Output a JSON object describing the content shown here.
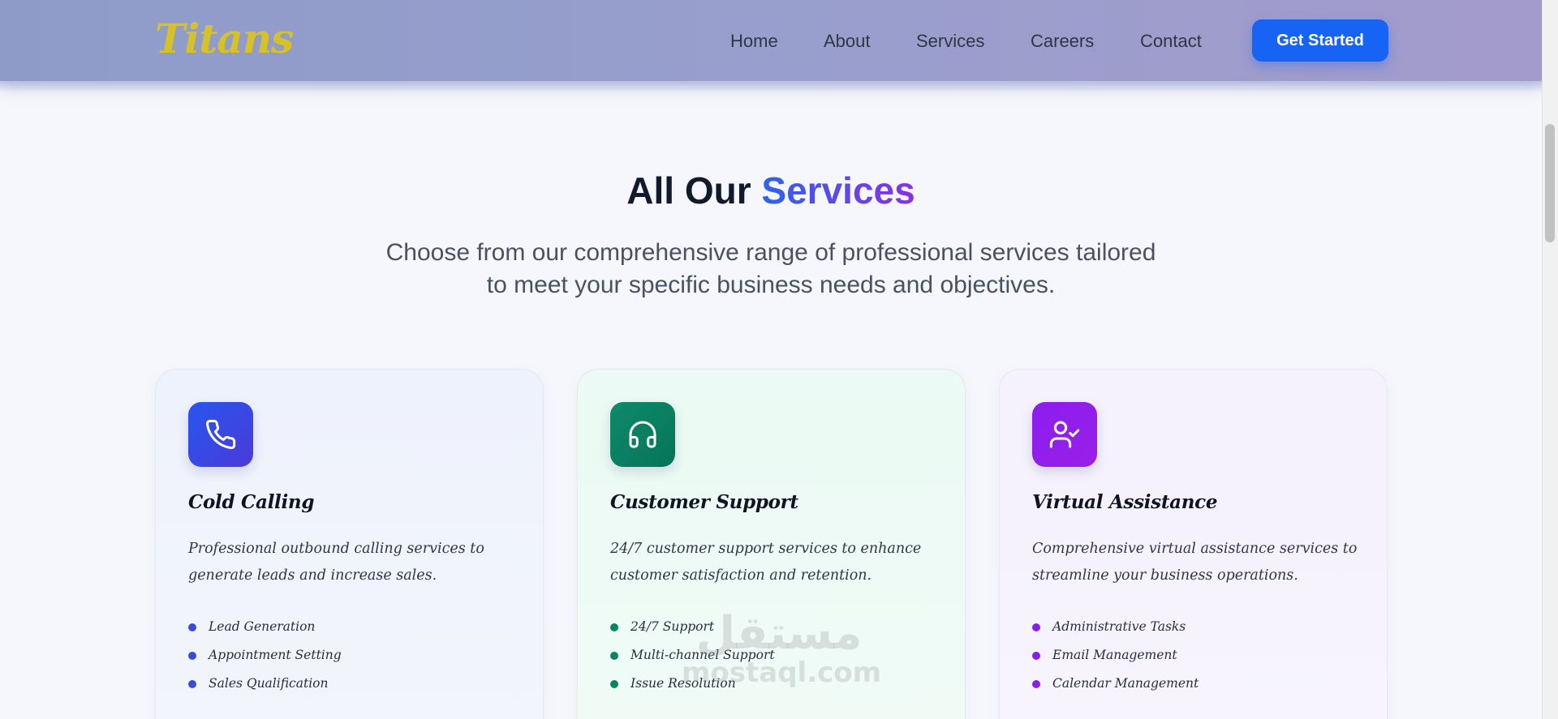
{
  "brand": {
    "logo": "Titans",
    "logo_color": "#d6c227"
  },
  "nav": {
    "items": [
      {
        "label": "Home"
      },
      {
        "label": "About"
      },
      {
        "label": "Services"
      },
      {
        "label": "Careers"
      },
      {
        "label": "Contact"
      }
    ],
    "cta_label": "Get Started",
    "cta_color": "#1763f3"
  },
  "section": {
    "title_prefix": "All Our",
    "title_accent": "Services",
    "subtitle": "Choose from our comprehensive range of professional services tailored to meet your specific business needs and objectives."
  },
  "cards": [
    {
      "icon": "phone-icon",
      "title": "Cold Calling",
      "description": "Professional outbound calling services to generate leads and increase sales.",
      "features": [
        "Lead Generation",
        "Appointment Setting",
        "Sales Qualification"
      ],
      "accent": "#3a4bd8"
    },
    {
      "icon": "headset-icon",
      "title": "Customer Support",
      "description": "24/7 customer support services to enhance customer satisfaction and retention.",
      "features": [
        "24/7 Support",
        "Multi-channel Support",
        "Issue Resolution"
      ],
      "accent": "#0b8462"
    },
    {
      "icon": "user-check-icon",
      "title": "Virtual Assistance",
      "description": "Comprehensive virtual assistance services to streamline your business operations.",
      "features": [
        "Administrative Tasks",
        "Email Management",
        "Calendar Management"
      ],
      "accent": "#8a1ee8"
    }
  ],
  "watermark": {
    "arabic": "مستقل",
    "latin": "mostaql.com"
  }
}
